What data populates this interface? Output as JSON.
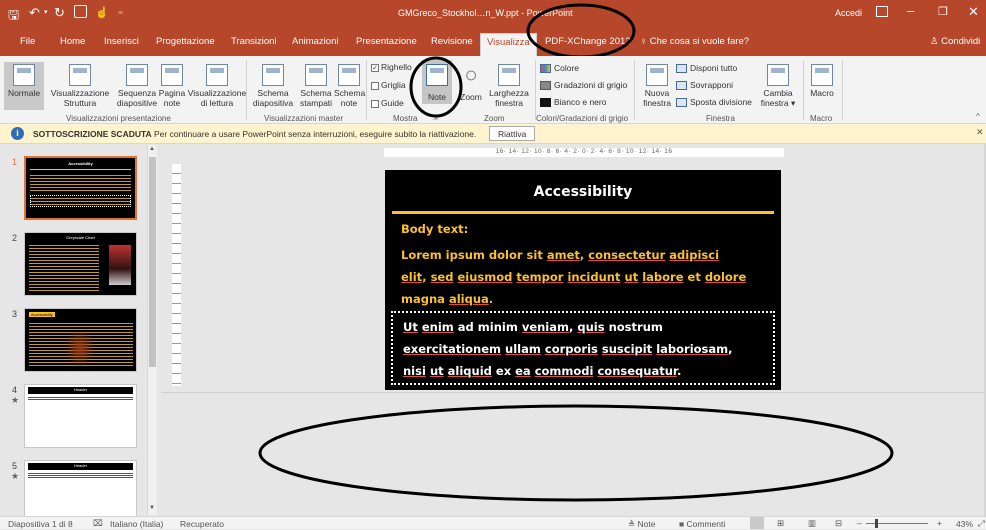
{
  "titlebar": {
    "qat_icons": [
      "save-icon",
      "undo-icon",
      "redo-icon",
      "present-icon",
      "touch-icon",
      "customize-icon"
    ],
    "title_left": "GMGreco_Stockhol",
    "title_mid": "…",
    "title_right": "n_W.ppt",
    "app_name": "PowerPoint",
    "signin": "Accedi",
    "color": "#b7472a"
  },
  "tabs": [
    "File",
    "Home",
    "Inserisci",
    "Progettazione",
    "Transizioni",
    "Animazioni",
    "Presentazione",
    "Revisione",
    "Visualizza",
    "PDF-XChange 2012"
  ],
  "active_tab": "Visualizza",
  "tell_me": "Che cosa si vuole fare?",
  "share": "Condividi",
  "ribbon": {
    "presentation_views": {
      "label": "Visualizzazioni presentazione",
      "buttons": [
        {
          "l1": "Normale",
          "l2": ""
        },
        {
          "l1": "Visualizzazione",
          "l2": "Struttura"
        },
        {
          "l1": "Sequenza",
          "l2": "diapositive"
        },
        {
          "l1": "Pagina",
          "l2": "note"
        },
        {
          "l1": "Visualizzazione",
          "l2": "di lettura"
        }
      ]
    },
    "master_views": {
      "label": "Visualizzazioni master",
      "buttons": [
        {
          "l1": "Schema",
          "l2": "diapositiva"
        },
        {
          "l1": "Schema",
          "l2": "stampati"
        },
        {
          "l1": "Schema",
          "l2": "note"
        }
      ]
    },
    "show": {
      "label": "Mostra",
      "ruler": "Righello",
      "gridlines": "Griglia",
      "guides": "Guide",
      "notes": "Note"
    },
    "zoom": {
      "label": "Zoom",
      "zoom": "Zoom",
      "fit_l1": "Larghezza",
      "fit_l2": "finestra"
    },
    "color": {
      "label": "Colori/Gradazioni di grigio",
      "items": [
        "Colore",
        "Gradazioni di grigio",
        "Bianco e nero"
      ]
    },
    "window": {
      "label": "Finestra",
      "new_l1": "Nuova",
      "new_l2": "finestra",
      "items": [
        "Disponi tutto",
        "Sovrapponi",
        "Sposta divisione"
      ],
      "switch_l1": "Cambia",
      "switch_l2": "finestra ▾"
    },
    "macro": {
      "label": "Macro",
      "button": "Macro"
    }
  },
  "message_bar": {
    "title": "SOTTOSCRIZIONE SCADUTA",
    "text": "Per continuare a usare PowerPoint senza interruzioni, eseguire subito la riattivazione.",
    "button": "Riattiva"
  },
  "ruler_labels": "16· 14· 12· 10· 8· 6· 4· 2· 0· 2· 4· 6· 8· 10· 12· 14· 16",
  "slide": {
    "title": "Accessibility",
    "body_label": "Body text:",
    "line1": [
      "Lorem ipsum dolor sit ",
      "amet",
      ", ",
      "consectetur",
      " ",
      "adipisci"
    ],
    "line2": [
      "elit",
      ", ",
      "sed",
      " ",
      "eiusmod",
      " ",
      "tempor",
      " ",
      "incidunt",
      " ",
      "ut",
      " ",
      "labore",
      " et ",
      "dolore"
    ],
    "line3": [
      "magna ",
      "aliqua",
      "."
    ],
    "box1": [
      "Ut",
      " ",
      "enim",
      " ad minim ",
      "veniam",
      ", ",
      "quis",
      " nostrum"
    ],
    "box2": [
      "exercitationem",
      " ",
      "ullam",
      " ",
      "corporis",
      " ",
      "suscipit",
      " ",
      "laboriosam",
      ","
    ],
    "box3": [
      "nisi",
      " ",
      "ut",
      " ",
      "aliquid",
      " ex ",
      "ea",
      " ",
      "commodi",
      " ",
      "consequatur",
      "."
    ]
  },
  "thumbnails": [
    {
      "num": "1",
      "title": "Accessibility"
    },
    {
      "num": "2",
      "title": "Greyscale Chart"
    },
    {
      "num": "3",
      "title": "Accessibility"
    },
    {
      "num": "4",
      "title": "Header"
    },
    {
      "num": "5",
      "title": "Header"
    }
  ],
  "statusbar": {
    "slide": "Diapositiva 1 di 8",
    "language": "Italiano (Italia)",
    "recovered": "Recuperato",
    "notes": "Note",
    "comments": "Commenti",
    "zoom": "43%"
  },
  "colors": {
    "accent": "#b7472a",
    "slide_bg": "#000000",
    "slide_text": "#fbc02d"
  }
}
